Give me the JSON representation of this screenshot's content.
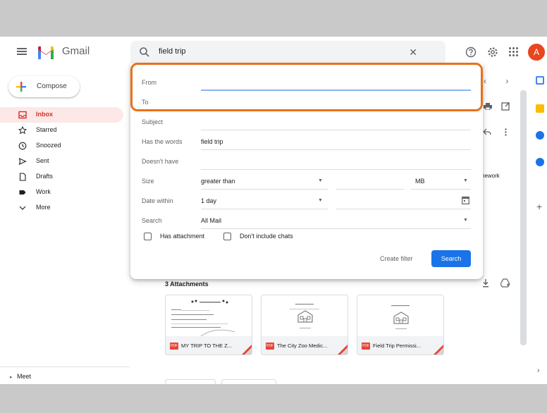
{
  "app": {
    "name": "Gmail",
    "avatar_initial": "A"
  },
  "search": {
    "query": "field trip"
  },
  "compose": {
    "label": "Compose"
  },
  "sidebar": {
    "items": [
      {
        "label": "Inbox",
        "icon": "inbox-icon",
        "active": true
      },
      {
        "label": "Starred",
        "icon": "star-icon"
      },
      {
        "label": "Snoozed",
        "icon": "clock-icon"
      },
      {
        "label": "Sent",
        "icon": "send-icon"
      },
      {
        "label": "Drafts",
        "icon": "draft-icon"
      },
      {
        "label": "Work",
        "icon": "label-icon"
      },
      {
        "label": "More",
        "icon": "chevron-down-icon"
      }
    ],
    "meet_label": "Meet"
  },
  "filter_panel": {
    "from_label": "From",
    "from_value": "",
    "to_label": "To",
    "to_value": "",
    "subject_label": "Subject",
    "subject_value": "",
    "has_words_label": "Has the words",
    "has_words_value": "field trip",
    "doesnt_have_label": "Doesn't have",
    "doesnt_have_value": "",
    "size_label": "Size",
    "size_operator": "greater than",
    "size_unit": "MB",
    "date_within_label": "Date within",
    "date_within_value": "1 day",
    "search_in_label": "Search",
    "search_in_value": "All Mail",
    "has_attachment_label": "Has attachment",
    "exclude_chats_label": "Don't include chats",
    "create_filter_label": "Create filter",
    "search_button_label": "Search"
  },
  "message": {
    "partial_text": "nework",
    "attachments_title": "3 Attachments",
    "attachments": [
      {
        "name": "MY TRIP TO THE Z...",
        "type": "PDF"
      },
      {
        "name": "The City Zoo Medic...",
        "type": "PDF"
      },
      {
        "name": "Field Trip Permissi...",
        "type": "PDF"
      }
    ]
  },
  "colors": {
    "gmail_red": "#ea4335",
    "highlight": "#e8711a",
    "primary_blue": "#1a73e8"
  }
}
